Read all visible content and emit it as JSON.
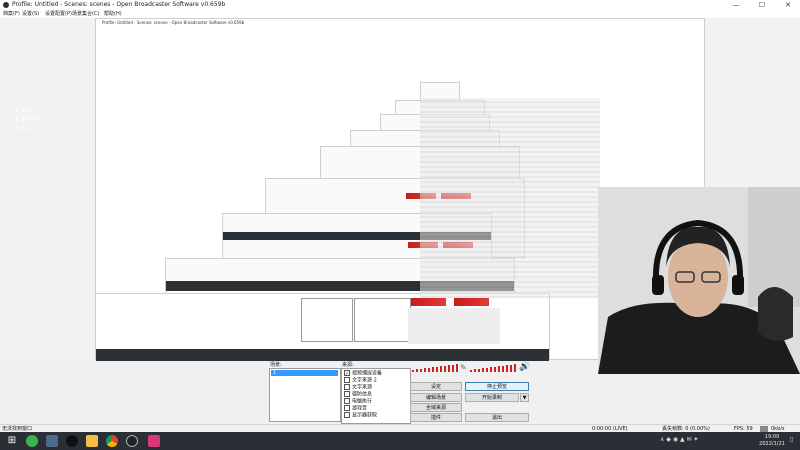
{
  "window": {
    "title": "Profile: Untitled - Scenes: scenes - Open Broadcaster Software v0.659b",
    "controls": {
      "minimize": "—",
      "maximize": "☐",
      "close": "✕"
    }
  },
  "menu": [
    "档案(F)",
    "设置(S)",
    "设置配置(P)",
    "场景集合(C)",
    "帮助(H)"
  ],
  "nested_title": "Profile: Untitled - Scenes: scenes - Open Broadcaster Software v0.659b",
  "scenes": {
    "label": "场景:",
    "items": [
      "1"
    ]
  },
  "sources": {
    "label": "来源:",
    "items": [
      "视频捕捉设备",
      "文字来源 2",
      "文字来源",
      "德防信息",
      "电脑执行",
      "游戏音",
      "显示器获取"
    ]
  },
  "buttons": {
    "settings": "设定",
    "stop_preview": "停止预览",
    "edit_scene": "编辑场景",
    "start_recording": "开始录制",
    "global_sources": "全域来源",
    "plugins": "插件",
    "exit": "退出",
    "dropdown": "▼"
  },
  "status": {
    "left": "无法找到窗口",
    "time": "0:00:00 (LIVE)",
    "dropped": "丢失帧数: 0 (0.00%)",
    "fps": "FPS: 59",
    "bitrate": "0kb/s"
  },
  "clock": {
    "time": "19:09",
    "date": "2022/1/21"
  },
  "taskbar_icons": [
    "start-icon",
    "wechat-icon",
    "task-icon",
    "qq-icon",
    "folder-icon",
    "chrome-icon",
    "obs-icon",
    "app-icon"
  ],
  "colors": {
    "accent": "#3c7fb1",
    "meter": "#cf1f1f",
    "taskbar": "#2a2f36"
  }
}
